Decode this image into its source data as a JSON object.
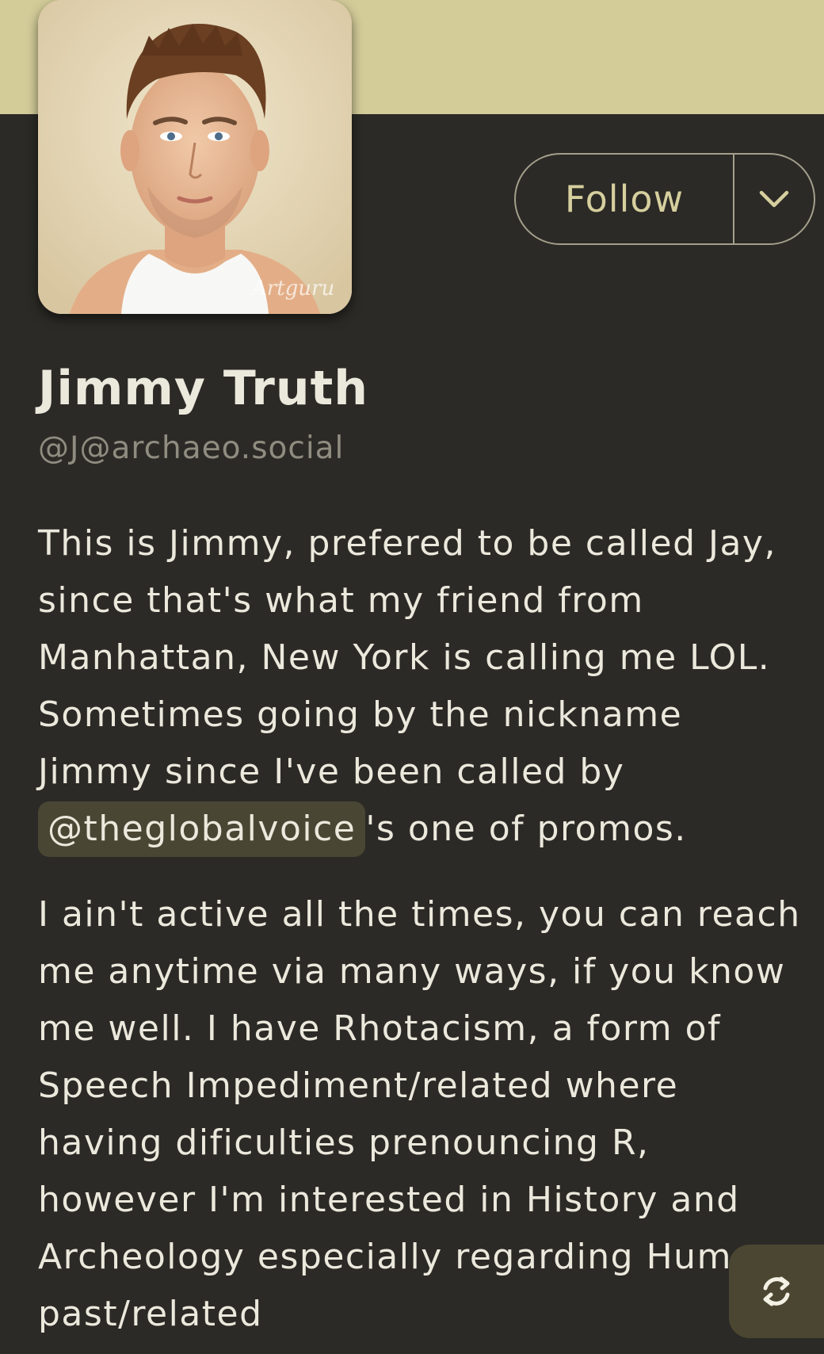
{
  "profile": {
    "display_name": "Jimmy Truth",
    "handle": "@J@archaeo.social",
    "avatar_watermark": "Artguru"
  },
  "actions": {
    "follow_label": "Follow",
    "follow_menu_icon": "chevron-down-icon",
    "refresh_icon": "refresh-icon"
  },
  "bio": {
    "p1": {
      "line1": "This is Jimmy, prefered to be called Jay,",
      "line2": "since that's what my friend from",
      "line3": "Manhattan, New York is calling me LOL.",
      "line4": "Sometimes going by the nickname",
      "line5": "Jimmy since I've been called by",
      "mention": "@theglobalvoice",
      "line6_rest": "'s one of promos."
    },
    "p2": {
      "line1": "I ain't active all the times, you can reach",
      "line2": "me anytime via many ways, if you know",
      "line3": "me well. I have Rhotacism, a form of",
      "line4": "Speech Impediment/related where",
      "line5": "having dificulties prenouncing R,",
      "line6": "however I'm interested in History and",
      "line7": "Archeology especially regarding Human",
      "line8": "past/related"
    }
  },
  "colors": {
    "banner": "#d3cc99",
    "background": "#2b2a26",
    "accent_text": "#d6cf9e",
    "mention_bg": "#4a4634",
    "fab_bg": "#4b4631"
  }
}
